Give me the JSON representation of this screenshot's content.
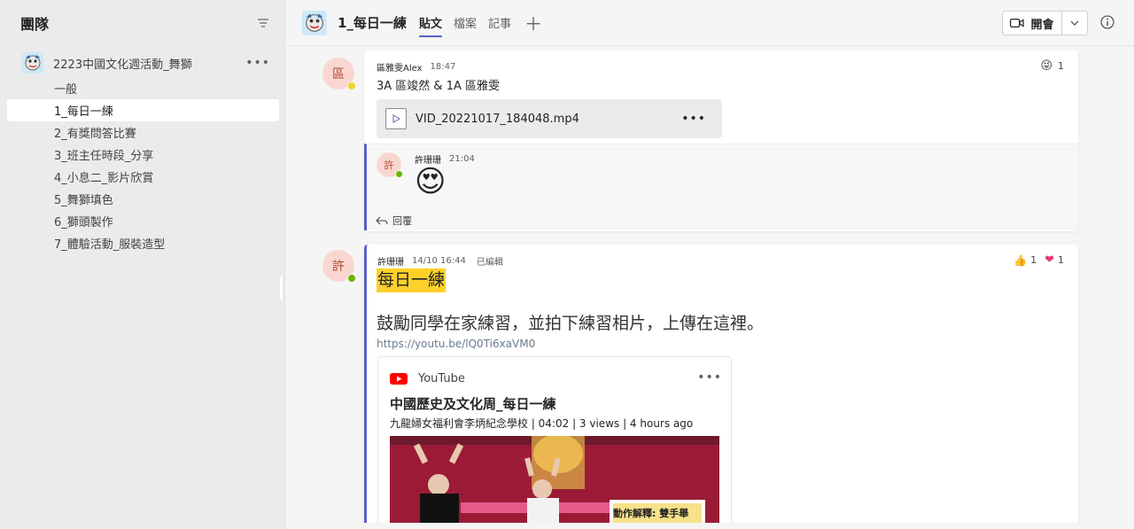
{
  "sidebar": {
    "title": "團隊",
    "team_name": "2223中國文化週活動_舞獅",
    "channels": [
      "一般",
      "1_每日一練",
      "2_有獎問答比賽",
      "3_班主任時段_分享",
      "4_小息二_影片欣賞",
      "5_舞獅填色",
      "6_獅頭製作",
      "7_體驗活動_服裝造型"
    ],
    "active_channel_index": 1
  },
  "topbar": {
    "channel_title": "1_每日一練",
    "tabs": [
      "貼文",
      "檔案",
      "記事"
    ],
    "active_tab_index": 0,
    "meet_label": "開會"
  },
  "post1": {
    "avatar_char": "區",
    "author": "區雅雯Alex",
    "time": "18:47",
    "body": "3A 區竣然 & 1A 區雅雯",
    "reaction_count": "1",
    "file_name": "VID_20221017_184048.mp4",
    "reply": {
      "avatar_char": "許",
      "author": "許珊珊",
      "time": "21:04",
      "emoji": "😍"
    },
    "reply_label": "回覆"
  },
  "post2": {
    "avatar_char": "許",
    "author": "許珊珊",
    "time": "14/10 16:44",
    "edited": "已編輯",
    "highlight_title": "每日一練",
    "body": "鼓勵同學在家練習，並拍下練習相片，上傳在這裡。",
    "link": "https://youtu.be/lQ0Ti6xaVM0",
    "reactions": [
      {
        "emoji": "👍",
        "count": "1"
      },
      {
        "emoji": "❤",
        "count": "1"
      }
    ],
    "youtube": {
      "source": "YouTube",
      "title": "中國歷史及文化周_每日一練",
      "subtitle": "九龍婦女福利會李炳紀念學校 | 04:02 | 3 views | 4 hours ago",
      "thumb_caption": "動作解釋: 雙手舉"
    }
  },
  "colors": {
    "accent": "#5b5fc7",
    "highlight": "#fcd12a",
    "sidebar_bg": "#ebebeb",
    "main_bg": "#f5f5f5",
    "link": "#6a7a8c",
    "youtube_red": "#ff0000",
    "online": "#6bb700",
    "away": "#f8d22a"
  }
}
